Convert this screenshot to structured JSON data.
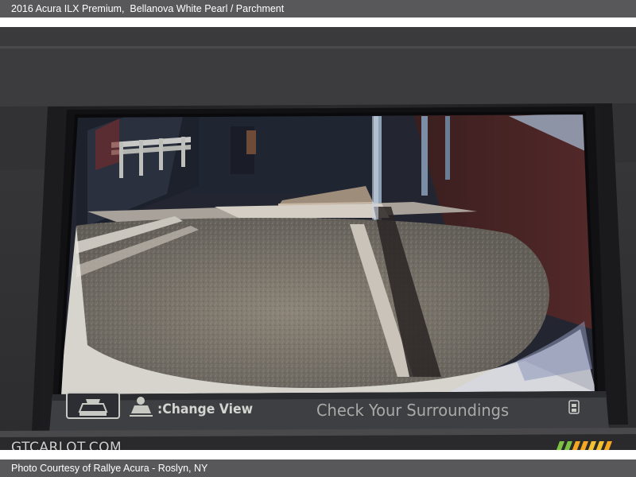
{
  "header": {
    "title": "2016 Acura ILX Premium,",
    "colors": "Bellanova White Pearl / Parchment"
  },
  "camera_screen": {
    "change_view_label": ":Change View",
    "check_surroundings_label": "Check Your Surroundings",
    "icons": [
      "camera-view-icon",
      "car-top-icon"
    ]
  },
  "watermark": {
    "text": "GTCARLOT.COM"
  },
  "footer": {
    "credit": "Photo Courtesy of Rallye Acura - Roslyn, NY"
  },
  "brand_colors": {
    "bar_gray": "#58585a",
    "logo_green": "#7cc242",
    "logo_orange": "#f5a623"
  }
}
